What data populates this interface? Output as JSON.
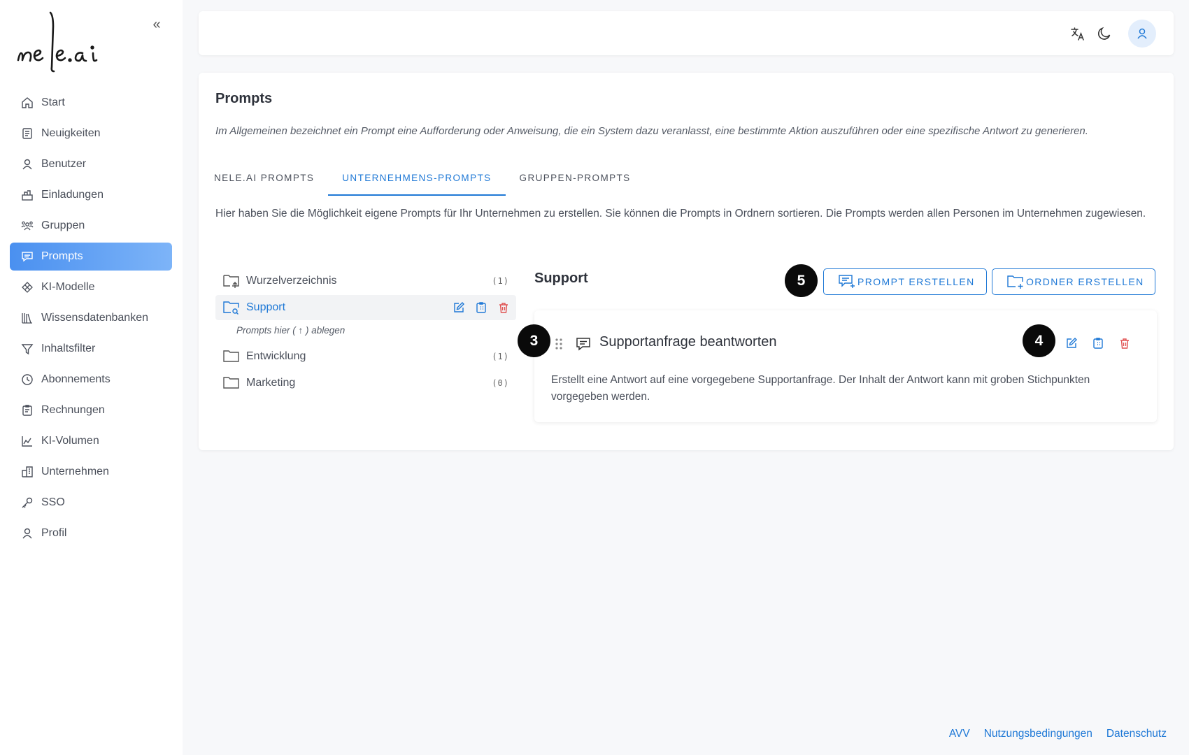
{
  "brand": {
    "logo_text": "nele.ai"
  },
  "sidebar": {
    "collapse_label": "«",
    "items": [
      {
        "label": "Start",
        "icon": "home-icon",
        "active": false
      },
      {
        "label": "Neuigkeiten",
        "icon": "news-icon",
        "active": false
      },
      {
        "label": "Benutzer",
        "icon": "user-icon",
        "active": false
      },
      {
        "label": "Einladungen",
        "icon": "invitations-icon",
        "active": false
      },
      {
        "label": "Gruppen",
        "icon": "groups-icon",
        "active": false
      },
      {
        "label": "Prompts",
        "icon": "prompts-icon",
        "active": true
      },
      {
        "label": "KI-Modelle",
        "icon": "ai-models-icon",
        "active": false
      },
      {
        "label": "Wissensdatenbanken",
        "icon": "knowledge-base-icon",
        "active": false
      },
      {
        "label": "Inhaltsfilter",
        "icon": "filter-icon",
        "active": false
      },
      {
        "label": "Abonnements",
        "icon": "clock-icon",
        "active": false
      },
      {
        "label": "Rechnungen",
        "icon": "invoice-icon",
        "active": false
      },
      {
        "label": "KI-Volumen",
        "icon": "chart-icon",
        "active": false
      },
      {
        "label": "Unternehmen",
        "icon": "building-icon",
        "active": false
      },
      {
        "label": "SSO",
        "icon": "key-icon",
        "active": false
      },
      {
        "label": "Profil",
        "icon": "profile-icon",
        "active": false
      }
    ]
  },
  "header": {
    "icons": [
      "translate-icon",
      "moon-icon",
      "user-avatar-icon"
    ]
  },
  "page": {
    "title": "Prompts",
    "description": "Im Allgemeinen bezeichnet ein Prompt eine Aufforderung oder Anweisung, die ein System dazu veranlasst, eine bestimmte Aktion auszuführen oder eine spezifische Antwort zu generieren.",
    "tabs": [
      {
        "label": "NELE.AI PROMPTS",
        "active": false
      },
      {
        "label": "UNTERNEHMENS-PROMPTS",
        "active": true
      },
      {
        "label": "GRUPPEN-PROMPTS",
        "active": false
      }
    ],
    "tab_description": "Hier haben Sie die Möglichkeit eigene Prompts für Ihr Unternehmen zu erstellen. Sie können die Prompts in Ordnern sortieren. Die Prompts werden allen Personen im Unternehmen zugewiesen."
  },
  "folders": {
    "items": [
      {
        "label": "Wurzelverzeichnis",
        "count": "(1)",
        "icon": "folder-up-icon"
      },
      {
        "label": "Support",
        "count": "",
        "icon": "folder-search-icon",
        "selected": true
      },
      {
        "label": "Entwicklung",
        "count": "(1)",
        "icon": "folder-icon"
      },
      {
        "label": "Marketing",
        "count": "(0)",
        "icon": "folder-icon"
      }
    ],
    "drop_hint": "Prompts hier ( ↑ ) ablegen"
  },
  "detail": {
    "folder_title": "Support",
    "create_prompt_label": "PROMPT ERSTELLEN",
    "create_folder_label": "ORDNER ERSTELLEN",
    "prompt": {
      "title": "Supportanfrage beantworten",
      "description": "Erstellt eine Antwort auf eine vorgegebene Supportanfrage. Der Inhalt der Antwort kann mit groben Stichpunkten vorgegeben werden."
    }
  },
  "badges": {
    "five": "5",
    "three": "3",
    "four": "4"
  },
  "footer": {
    "links": [
      "AVV",
      "Nutzungsbedingungen",
      "Datenschutz"
    ]
  },
  "colors": {
    "accent": "#1e78d6",
    "active_nav_start": "#4a90f0",
    "active_nav_end": "#7db4f8",
    "danger": "#e05252",
    "badge": "#0a0a0a"
  }
}
